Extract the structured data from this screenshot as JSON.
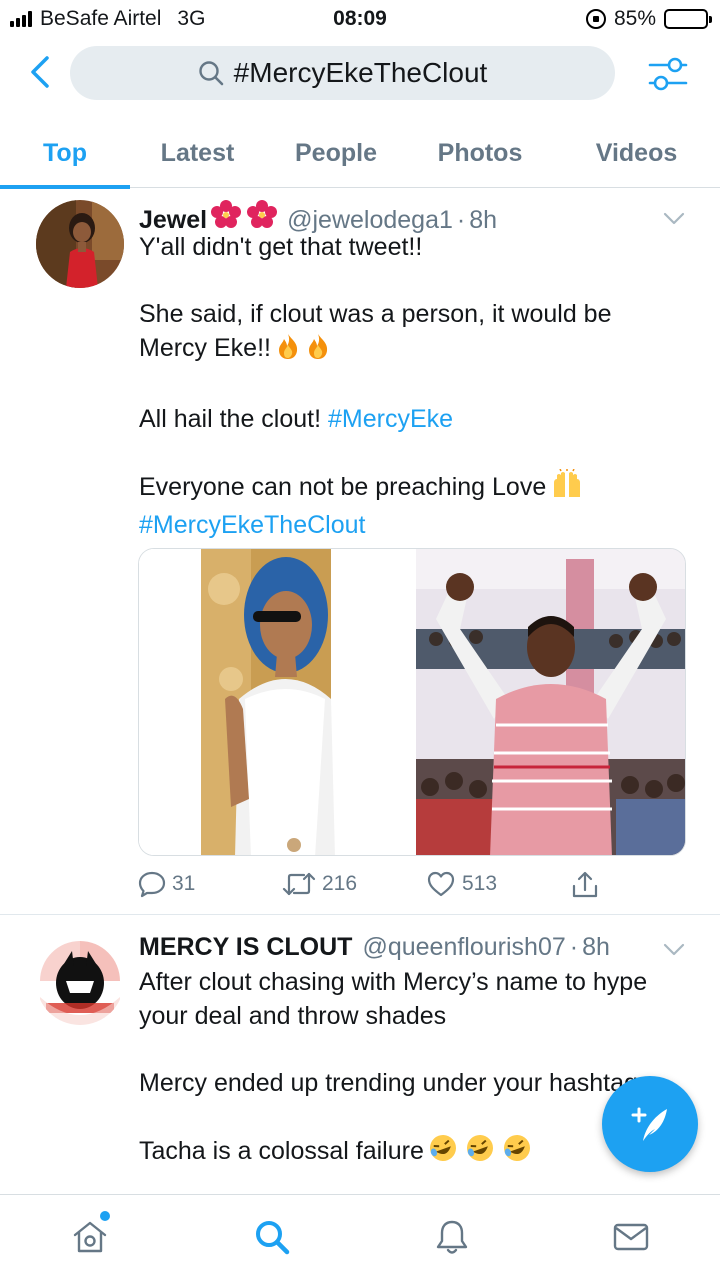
{
  "status_bar": {
    "carrier": "BeSafe Airtel",
    "network": "3G",
    "time": "08:09",
    "battery": "85%",
    "battery_level": 0.85
  },
  "search": {
    "query": "#MercyEkeTheClout"
  },
  "tabs": [
    {
      "label": "Top",
      "active": true
    },
    {
      "label": "Latest",
      "active": false
    },
    {
      "label": "People",
      "active": false
    },
    {
      "label": "Photos",
      "active": false
    },
    {
      "label": "Videos",
      "active": false
    }
  ],
  "tweets": [
    {
      "display_name": "Jewel",
      "name_emoji": "hibiscus-icon",
      "handle": "@jewelodega1",
      "dot": "·",
      "time": "8h",
      "lines": {
        "l1": "Y'all didn't get that tweet!!",
        "l2": "She said, if clout was a person, it would be Mercy Eke!!",
        "l3_text": "All hail the clout! ",
        "l3_link": "#MercyEke",
        "l4": "Everyone can not be preaching Love",
        "l4_link": "#MercyEkeTheClout"
      },
      "emojis": [
        "fire-icon",
        "raised-hands-icon"
      ],
      "actions": {
        "replies": "31",
        "retweets": "216",
        "likes": "513"
      }
    },
    {
      "display_name": "MERCY IS CLOUT",
      "handle": "@queenflourish07",
      "dot": "·",
      "time": "8h",
      "lines": {
        "l1": "After clout chasing with Mercy’s name to hype your deal and throw shades",
        "l2": "Mercy ended up trending under your hashtags",
        "l3": "Tacha is a colossal failure"
      },
      "emojis": [
        "rolling-laughing-icon"
      ]
    }
  ],
  "colors": {
    "accent": "#1da1f2",
    "secondary_text": "#657786",
    "primary_text": "#14171a",
    "search_bg": "#e6ecf0"
  }
}
